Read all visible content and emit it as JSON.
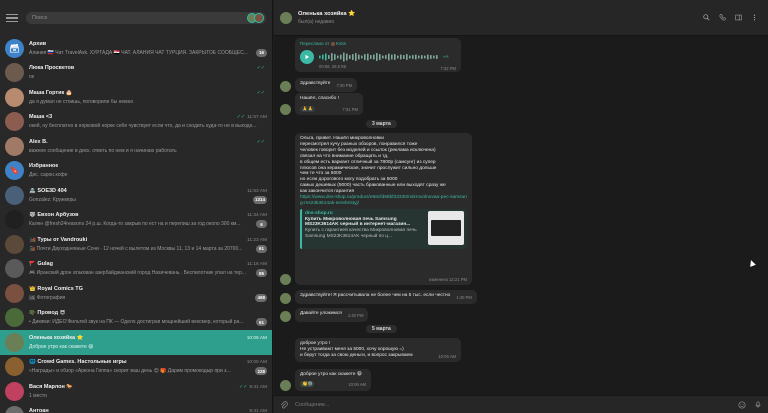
{
  "search": {
    "placeholder": "Поиск"
  },
  "chats": [
    {
      "name": "Архив",
      "preview": "Алания 🇷🇺 Чат TravelAsk. ХУРГАДА 🇪🇬 ЧАТ. АЛАНИЯ ЧАТ ТУРЦИЯ. ЗАКРЫТОЕ СООБЩЕС...",
      "time": "",
      "badge": "16",
      "avatar_color": "#3e82c8",
      "avatar_glyph": "🗃",
      "checks": ""
    },
    {
      "name": "Люка Просветов",
      "preview": "ок",
      "time": "",
      "badge": "",
      "avatar_color": "#6d5a4e",
      "avatar_glyph": "",
      "checks": "✓✓"
    },
    {
      "name": "Маша Гортик 🎂",
      "preview": "да я думал не стоишь, поговорили бы немно",
      "time": "",
      "badge": "",
      "avatar_color": "#b88a70",
      "avatar_glyph": "",
      "checks": "✓✓"
    },
    {
      "name": "Маша <3",
      "preview": "окей, ну бесплатно в норковой норке себе чувствует если что, да и сходить куда-то не в выходн...",
      "time": "11:57 AM",
      "badge": "",
      "avatar_color": "#8c5c50",
      "avatar_glyph": "",
      "checks": "✓✓"
    },
    {
      "name": "Alex B.",
      "preview": "важное сообщение в диск. ответь по нем и я начинаю работать",
      "time": "",
      "badge": "",
      "avatar_color": "#a07a66",
      "avatar_glyph": "",
      "checks": "✓✓"
    },
    {
      "name": "Избранное",
      "preview": "Дис. сарон.кофе",
      "time": "",
      "badge": "",
      "avatar_color": "#3e82c8",
      "avatar_glyph": "🔖",
      "checks": ""
    },
    {
      "name": "🏯 SOE3D 404",
      "preview": "Gonzalez: Кружкеры",
      "time": "11:53 AM",
      "badge": "1314",
      "avatar_color": "#4a5f78",
      "avatar_glyph": "",
      "checks": ""
    },
    {
      "name": "🐺 Евхон Арбузов",
      "preview": "Кален @fresh24reasons 24 р.ш. Когда-то закрыв по ест на и перепиш за год около 300 км...",
      "time": "11:34 AM",
      "badge": "6",
      "avatar_color": "#202020",
      "avatar_glyph": "",
      "checks": ""
    },
    {
      "name": "🚂 Туры от Vandrouki",
      "preview": "🚂 Почти Двуходневные Сочи · 12 ночей с вылетом из Москвы 11, 13 и 14 марта за 20700...",
      "time": "11:23 AM",
      "badge": "61",
      "avatar_color": "#5b4a3a",
      "avatar_glyph": "",
      "checks": ""
    },
    {
      "name": "🚩 Gulag",
      "preview": "🎮 Иранский дрон атакован азербайджанский город Нахичевань . Беспилотник упал на тер...",
      "time": "11:16 AM",
      "badge": "86",
      "avatar_color": "#5a5a5a",
      "avatar_glyph": "",
      "checks": ""
    },
    {
      "name": "👑 Royal Comics TG",
      "preview": "🖼 Фотография",
      "time": "",
      "badge": "468",
      "avatar_color": "#7a5040",
      "avatar_glyph": "",
      "checks": ""
    },
    {
      "name": "🪖 Провод 😎",
      "preview": "• Дикими: ИДЕО'Фильтей звук на ПК — Одело достиграя мощнейший вексмер, который ра...",
      "time": "",
      "badge": "61",
      "avatar_color": "#4a6a3a",
      "avatar_glyph": "",
      "checks": ""
    },
    {
      "name": "Оленька хозяйка ⭐",
      "preview": "Доброе утро как скажете 😄",
      "time": "10:06 AM",
      "badge": "",
      "avatar_color": "#6a7f56",
      "avatar_glyph": "",
      "checks": ""
    },
    {
      "name": "🌐 Crowd Games. Настольные игры",
      "preview": "«Награды» и обзор «Аркона Гиппа» скорит ваш день 😍 🎁 Дарим промокодыр при з...",
      "time": "10:00 AM",
      "badge": "228",
      "avatar_color": "#8a6030",
      "avatar_glyph": "",
      "checks": ""
    },
    {
      "name": "Вася Марлон 🐎",
      "preview": "1 место",
      "time": "9:41 AM",
      "badge": "",
      "avatar_color": "#c04060",
      "avatar_glyph": "",
      "checks": "✓✓"
    },
    {
      "name": "Антоан",
      "preview": "",
      "time": "9:41 AM",
      "badge": "",
      "avatar_color": "#6c6c6c",
      "avatar_glyph": "",
      "checks": ""
    }
  ],
  "header": {
    "name": "Оленька хозяйка ⭐",
    "status": "был(а) недавно"
  },
  "messages": {
    "forwarded_label": "Переслано от",
    "forwarded_from": "Ksss",
    "voice_duration": "00:59, 29,5 КБ",
    "voice_time": "7:32 PM",
    "m1_text": "Здравствуйте",
    "m1_time": "7:30 PM",
    "m2_text": "Нашёл, спасибо !",
    "m2_emoji": "🙏🙏",
    "m2_time": "7:31 PM",
    "date1": "3 марта",
    "m3_text": "Ольга, привет. Нашёл микроволновки\nпересмотрел кучу разных обзоров, понравился тоже\nчеловек говорит без моделей и ссылок (реклама исключена)\nсвязал на что внимание обращать и тд,\nв общем есть вариант отличный за 7800р (самсунг) из супер\nплюсов она керамическая, значит прослужит сильно дольше\nчем те что за 5000\nно если дорогового могу подобрать за 5000\nсамых дешевых (5000) часть бракованные или выходят сразу же\nкак закончится гарантия",
    "m3_link": "https://www.dns-shop.ru/product/e56cfd68bf33330/mikrovolnovaa-pec-samsung-ms23k3614ak-serebristyj/",
    "preview_site": "dns-shop.ru",
    "preview_title": "Купить Микроволновая печь Samsung MS23K3614AK черный в интернет-магазин...",
    "preview_desc": "Купить с гарантией качества Микроволновая печь Samsung MS23K3614AK черный по ц...",
    "m3_time": "изменено 12:21 PM",
    "m4_text": "Здравствуйте! Я рассчитывала не более чем на 5 тыс. если честно",
    "m4_time": "1:40 PM",
    "m5_text": "Давайте уложимся",
    "m5_time": "1:40 PM",
    "date2": "5 марта",
    "m6_text": "доброе утро !\nНе устраивают меня за 5000, хочу хорошую =)\nи берут тогда за свою деньги, и вопрос закрываем",
    "m6_time": "10:06 AM",
    "m7_text": "Доброе утро как скажете 😄",
    "m7_time": "10:06 AM"
  },
  "composer": {
    "placeholder": "Сообщение..."
  },
  "colors": {
    "accent": "#2e9f8c",
    "panel": "#282828",
    "bubble": "#2b2b2b",
    "check": "#2fb59d"
  }
}
